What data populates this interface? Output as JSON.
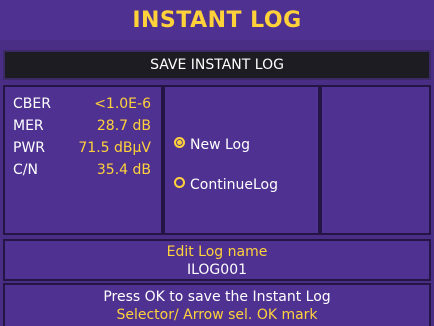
{
  "title": "INSTANT LOG",
  "save_button": "SAVE INSTANT LOG",
  "measurements": [
    {
      "label": "CBER",
      "value": "<1.0E-6"
    },
    {
      "label": "MER",
      "value": "28.7 dB"
    },
    {
      "label": "PWR",
      "value": "71.5 dBµV"
    },
    {
      "label": "C/N",
      "value": "35.4 dB"
    }
  ],
  "options": [
    {
      "label": "New Log",
      "selected": true
    },
    {
      "label": "ContinueLog",
      "selected": false
    }
  ],
  "edit": {
    "label": "Edit Log name",
    "value": "ILOG001"
  },
  "help": {
    "line1": "Press OK to save the Instant Log",
    "line2": "Selector/ Arrow sel. OK  mark"
  },
  "colors": {
    "background": "#4a2e86",
    "accent": "#ffd23a",
    "text": "#ffffff",
    "border": "#241544"
  }
}
